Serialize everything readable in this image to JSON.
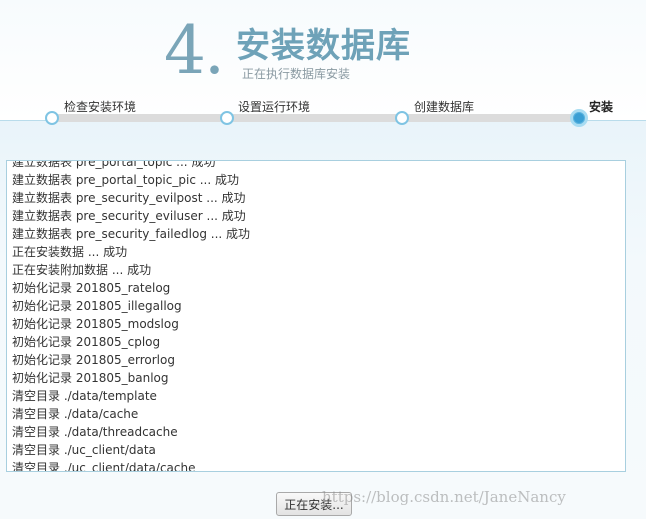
{
  "header": {
    "step_number": "4",
    "step_dot": ".",
    "title": "安装数据库",
    "subtitle": "正在执行数据库安装"
  },
  "steps": [
    {
      "label": "检查安装环境",
      "active": false
    },
    {
      "label": "设置运行环境",
      "active": false
    },
    {
      "label": "创建数据库",
      "active": false
    },
    {
      "label": "安装",
      "active": true
    }
  ],
  "log": {
    "lines": [
      "建立数据表 pre_portal_topic ... 成功",
      "建立数据表 pre_portal_topic_pic ... 成功",
      "建立数据表 pre_security_evilpost ... 成功",
      "建立数据表 pre_security_eviluser ... 成功",
      "建立数据表 pre_security_failedlog ... 成功",
      "正在安装数据 ... 成功",
      "正在安装附加数据 ... 成功",
      "初始化记录 201805_ratelog",
      "初始化记录 201805_illegallog",
      "初始化记录 201805_modslog",
      "初始化记录 201805_cplog",
      "初始化记录 201805_errorlog",
      "初始化记录 201805_banlog",
      "清空目录 ./data/template",
      "清空目录 ./data/cache",
      "清空目录 ./data/threadcache",
      "清空目录 ./uc_client/data",
      "清空目录 ./uc_client/data/cache"
    ]
  },
  "footer": {
    "install_button_label": "正在安装...",
    "watermark": "https://blog.csdn.net/JaneNancy"
  },
  "colors": {
    "accent": "#6ea2b8",
    "active_node": "#3a9fd4",
    "node_border": "#7fc4e3"
  }
}
